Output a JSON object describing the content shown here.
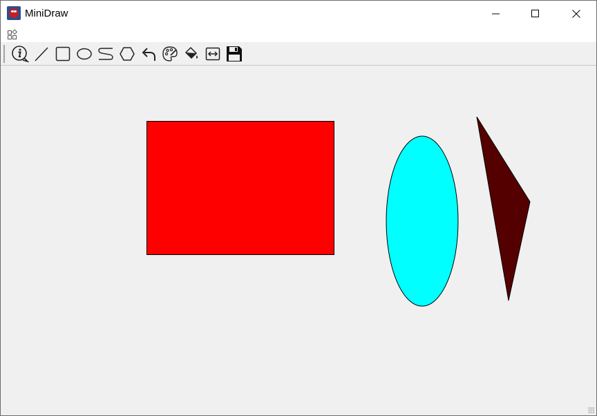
{
  "window": {
    "title": "MiniDraw",
    "app_icon": "spider-mask-app-icon",
    "controls": [
      "minimize-icon",
      "maximize-icon",
      "close-icon"
    ]
  },
  "menubar": {
    "icon": "menu-grid-icon"
  },
  "toolbar": {
    "tools": [
      {
        "name": "about",
        "icon": "info-bubble-icon"
      },
      {
        "name": "line",
        "icon": "line-icon"
      },
      {
        "name": "rectangle",
        "icon": "rectangle-icon"
      },
      {
        "name": "ellipse",
        "icon": "ellipse-icon"
      },
      {
        "name": "freehand",
        "icon": "freehand-icon"
      },
      {
        "name": "polygon",
        "icon": "polygon-icon"
      },
      {
        "name": "undo",
        "icon": "undo-arrow-icon"
      },
      {
        "name": "color",
        "icon": "palette-icon"
      },
      {
        "name": "fill",
        "icon": "paint-bucket-icon"
      },
      {
        "name": "line-width",
        "icon": "width-arrows-icon"
      },
      {
        "name": "save",
        "icon": "floppy-disk-icon"
      }
    ]
  },
  "canvas": {
    "background": "#f0f0f0",
    "shapes": [
      {
        "kind": "rectangle",
        "fill": "#ff0000",
        "stroke": "#000000"
      },
      {
        "kind": "ellipse",
        "fill": "#00ffff",
        "stroke": "#000000"
      },
      {
        "kind": "polygon",
        "fill": "#550000",
        "stroke": "#000000"
      }
    ]
  }
}
